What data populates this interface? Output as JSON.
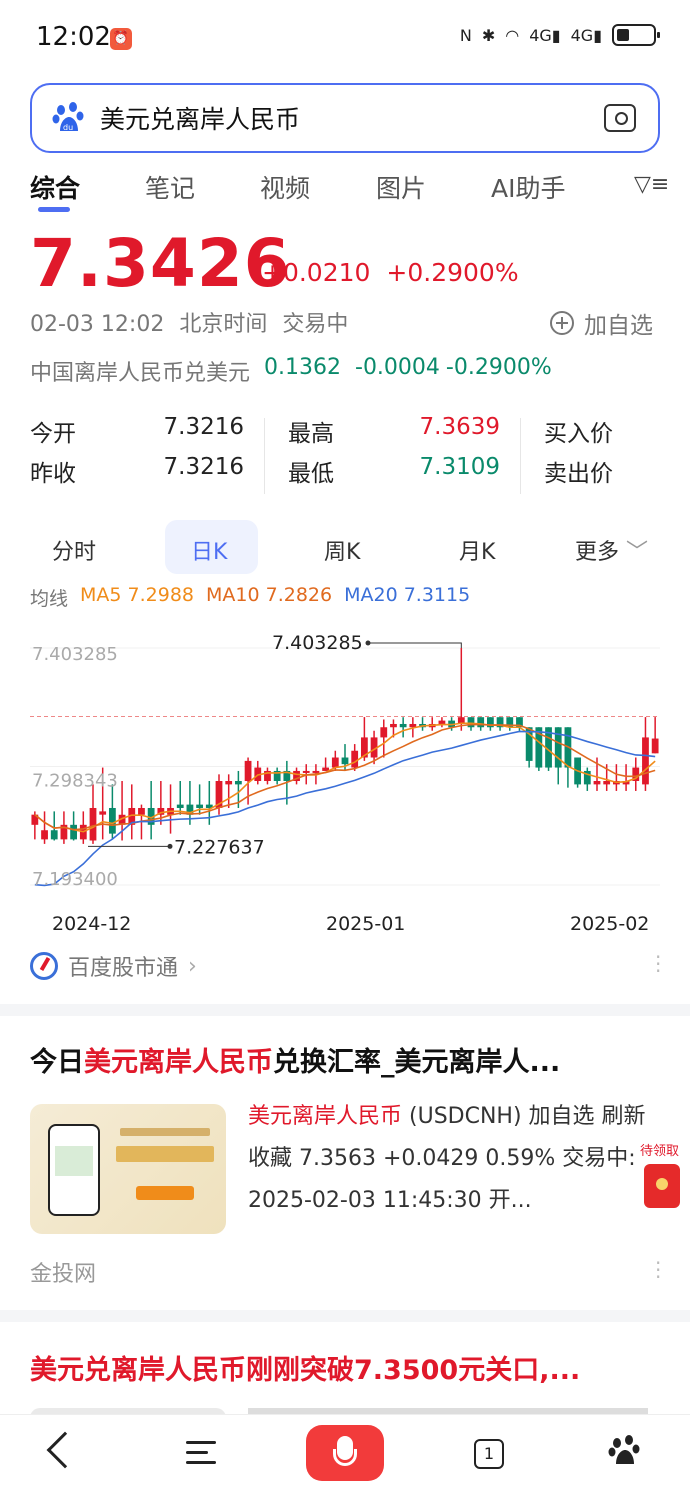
{
  "status_bar": {
    "time": "12:02",
    "icons": [
      "nfc-icon",
      "bluetooth-icon",
      "wifi-icon",
      "signal-4g-icon",
      "signal-4g-icon",
      "battery-icon"
    ],
    "net1": "4G",
    "net2": "4G"
  },
  "search": {
    "query": "美元兑离岸人民币"
  },
  "tabs": [
    {
      "label": "综合",
      "active": true
    },
    {
      "label": "笔记"
    },
    {
      "label": "视频"
    },
    {
      "label": "图片"
    },
    {
      "label": "AI助手"
    }
  ],
  "quote": {
    "price": "7.3426",
    "change": "+0.0210",
    "change_pct": "+0.2900%",
    "timestamp": "02-03 12:02",
    "tz": "北京时间",
    "status": "交易中",
    "add_watch": "加自选",
    "cnh_label": "中国离岸人民币兑美元",
    "cnh_price": "0.1362",
    "cnh_change": "-0.0004",
    "cnh_change_pct": "-0.2900%"
  },
  "stats": {
    "open_label": "今开",
    "open": "7.3216",
    "prev_label": "昨收",
    "prev": "7.3216",
    "high_label": "最高",
    "high": "7.3639",
    "low_label": "最低",
    "low": "7.3109",
    "bid_label": "买入价",
    "ask_label": "卖出价"
  },
  "periods": {
    "items": [
      "分时",
      "日K",
      "周K",
      "月K",
      "更多"
    ],
    "active": "日K"
  },
  "ma": {
    "label": "均线",
    "ma5": "MA5 7.2988",
    "ma10": "MA10 7.2826",
    "ma20": "MA20 7.3115"
  },
  "chart_data": {
    "type": "candlestick",
    "ylim": [
      7.1934,
      7.403285
    ],
    "y_ticks": [
      "7.403285",
      "7.298343",
      "7.193400"
    ],
    "x_ticks": [
      "2024-12",
      "2025-01",
      "2025-02"
    ],
    "max_label": "7.403285",
    "min_label": "7.227637",
    "reference_price": 7.3426,
    "colors": {
      "up": "#e0192b",
      "down": "#0a8a6b",
      "ma5": "#f08c1a",
      "ma10": "#e06a1f",
      "ma20": "#3a6fd8"
    },
    "candles": [
      [
        7.2467,
        7.2557,
        7.2338,
        7.2586
      ],
      [
        7.2338,
        7.2419,
        7.2298,
        7.2586
      ],
      [
        7.2419,
        7.2338,
        7.2328,
        7.2586
      ],
      [
        7.2338,
        7.2467,
        7.2298,
        7.2586
      ],
      [
        7.2467,
        7.2338,
        7.2328,
        7.2586
      ],
      [
        7.2338,
        7.2467,
        7.2298,
        7.2586
      ],
      [
        7.2328,
        7.2616,
        7.2298,
        7.2825
      ],
      [
        7.2557,
        7.2586,
        7.2338,
        7.2974
      ],
      [
        7.2616,
        7.2389,
        7.2338,
        7.2825
      ],
      [
        7.2467,
        7.2556,
        7.2328,
        7.2855
      ],
      [
        7.2467,
        7.2616,
        7.2338,
        7.2825
      ],
      [
        7.2556,
        7.2616,
        7.2338,
        7.2646
      ],
      [
        7.2616,
        7.2467,
        7.2338,
        7.2855
      ],
      [
        7.2556,
        7.2616,
        7.2467,
        7.2855
      ],
      [
        7.2556,
        7.2616,
        7.2389,
        7.2825
      ],
      [
        7.2646,
        7.2616,
        7.2556,
        7.2855
      ],
      [
        7.2646,
        7.2556,
        7.2467,
        7.2855
      ],
      [
        7.2646,
        7.2616,
        7.2556,
        7.2825
      ],
      [
        7.2646,
        7.2616,
        7.2467,
        7.2855
      ],
      [
        7.2616,
        7.2855,
        7.2556,
        7.2914
      ],
      [
        7.2825,
        7.2855,
        7.2616,
        7.2914
      ],
      [
        7.2855,
        7.2825,
        7.2616,
        7.2944
      ],
      [
        7.2855,
        7.3033,
        7.2646,
        7.3063
      ],
      [
        7.2855,
        7.2974,
        7.2825,
        7.3033
      ],
      [
        7.2855,
        7.2944,
        7.2825,
        7.2974
      ],
      [
        7.2944,
        7.2855,
        7.2825,
        7.2974
      ],
      [
        7.2944,
        7.2855,
        7.2646,
        7.3033
      ],
      [
        7.2855,
        7.2944,
        7.2825,
        7.2974
      ],
      [
        7.2944,
        7.2944,
        7.2825,
        7.3004
      ],
      [
        7.2944,
        7.2944,
        7.2825,
        7.3004
      ],
      [
        7.2944,
        7.2974,
        7.2944,
        7.3063
      ],
      [
        7.2974,
        7.3063,
        7.2944,
        7.3123
      ],
      [
        7.3063,
        7.3004,
        7.2944,
        7.3182
      ],
      [
        7.2974,
        7.3123,
        7.2944,
        7.3182
      ],
      [
        7.3063,
        7.3241,
        7.3033,
        7.3421
      ],
      [
        7.3063,
        7.3241,
        7.3004,
        7.33
      ],
      [
        7.3241,
        7.3331,
        7.3063,
        7.34
      ],
      [
        7.3331,
        7.336,
        7.3241,
        7.34
      ],
      [
        7.336,
        7.3331,
        7.3241,
        7.342
      ],
      [
        7.3331,
        7.336,
        7.3241,
        7.342
      ],
      [
        7.336,
        7.3331,
        7.33,
        7.342
      ],
      [
        7.3331,
        7.336,
        7.33,
        7.342
      ],
      [
        7.336,
        7.339,
        7.3331,
        7.342
      ],
      [
        7.339,
        7.3331,
        7.33,
        7.342
      ],
      [
        7.336,
        7.342,
        7.33,
        7.4033
      ],
      [
        7.342,
        7.3331,
        7.33,
        7.342
      ],
      [
        7.342,
        7.3331,
        7.33,
        7.342
      ],
      [
        7.342,
        7.3331,
        7.33,
        7.342
      ],
      [
        7.342,
        7.3331,
        7.33,
        7.342
      ],
      [
        7.342,
        7.3331,
        7.33,
        7.342
      ],
      [
        7.342,
        7.3331,
        7.33,
        7.342
      ],
      [
        7.3331,
        7.3033,
        7.2974,
        7.3331
      ],
      [
        7.3331,
        7.2974,
        7.2944,
        7.3331
      ],
      [
        7.3331,
        7.2974,
        7.2944,
        7.3331
      ],
      [
        7.3331,
        7.2974,
        7.2825,
        7.3331
      ],
      [
        7.3331,
        7.2974,
        7.2796,
        7.3331
      ],
      [
        7.3063,
        7.2825,
        7.2796,
        7.3063
      ],
      [
        7.2944,
        7.2825,
        7.2767,
        7.2974
      ],
      [
        7.2825,
        7.2855,
        7.2767,
        7.3063
      ],
      [
        7.2825,
        7.2855,
        7.2767,
        7.3004
      ],
      [
        7.2825,
        7.2855,
        7.2767,
        7.3004
      ],
      [
        7.2825,
        7.2855,
        7.2767,
        7.3004
      ],
      [
        7.2855,
        7.2974,
        7.2767,
        7.3063
      ],
      [
        7.2825,
        7.3241,
        7.2767,
        7.3421
      ],
      [
        7.31,
        7.3231,
        7.31,
        7.3421
      ]
    ]
  },
  "source": {
    "name": "百度股市通"
  },
  "result1": {
    "title_prefix": "今日",
    "title_highlight": "美元离岸人民币",
    "title_rest": "兑换汇率_美元离岸人...",
    "text_highlight": "美元离岸人民币",
    "text_rest": " (USDCNH) 加自选 刷新 收藏 7.3563 +0.0429 0.59% 交易中: 2025-02-03 11:45:30 开...",
    "site": "金投网",
    "redpacket_label": "待领取"
  },
  "result2": {
    "title": "美元兑离岸人民币刚刚突破7.3500元关口,..."
  },
  "nav": {
    "tabs_count": "1"
  }
}
